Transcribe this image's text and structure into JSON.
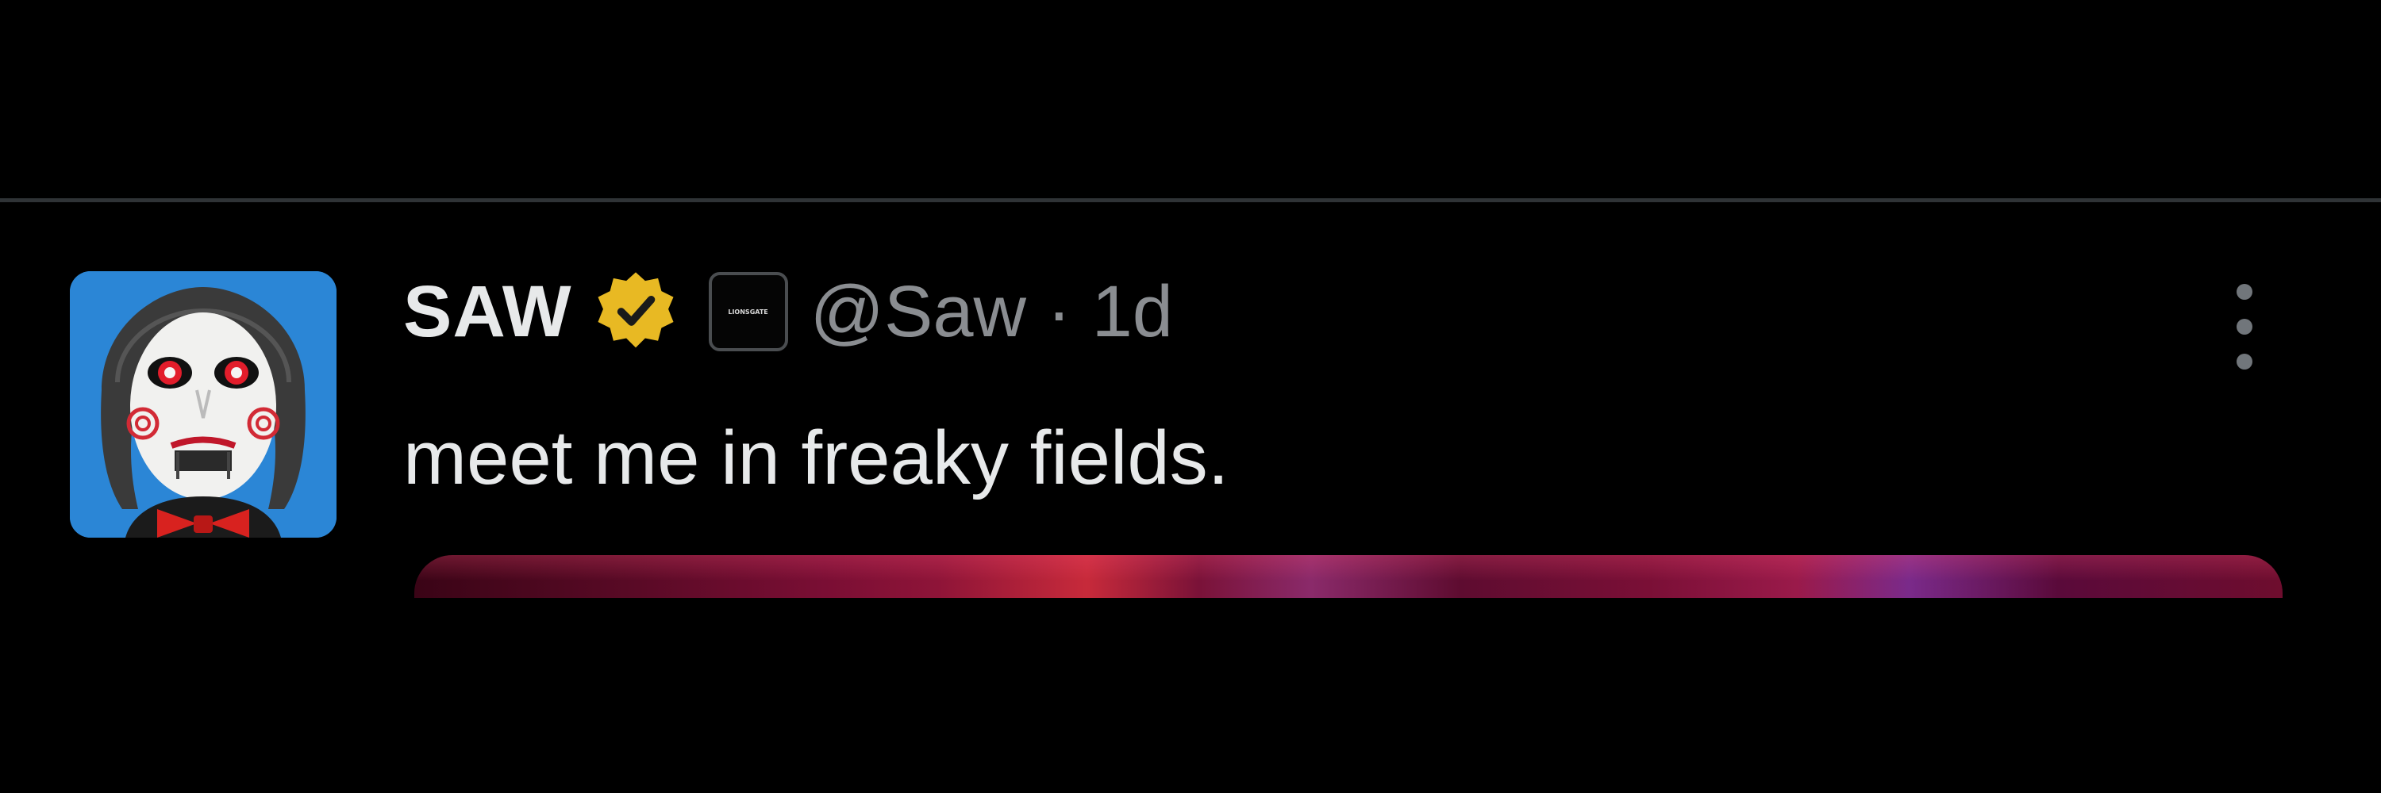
{
  "tweet": {
    "display_name": "SAW",
    "handle": "@Saw",
    "separator": "·",
    "timestamp": "1d",
    "text": "meet me in freaky fields.",
    "avatar_icon": "jigsaw-puppet-avatar",
    "verified_icon": "verified-gold-badge",
    "affiliate_badge_text": "LIONSGATE",
    "more_icon": "more-vertical-icon"
  },
  "colors": {
    "background": "#000000",
    "primary_text": "#e7e9ea",
    "secondary_text": "#8a8d91",
    "verified_badge": "#e8b923",
    "divider": "#2f3336"
  }
}
